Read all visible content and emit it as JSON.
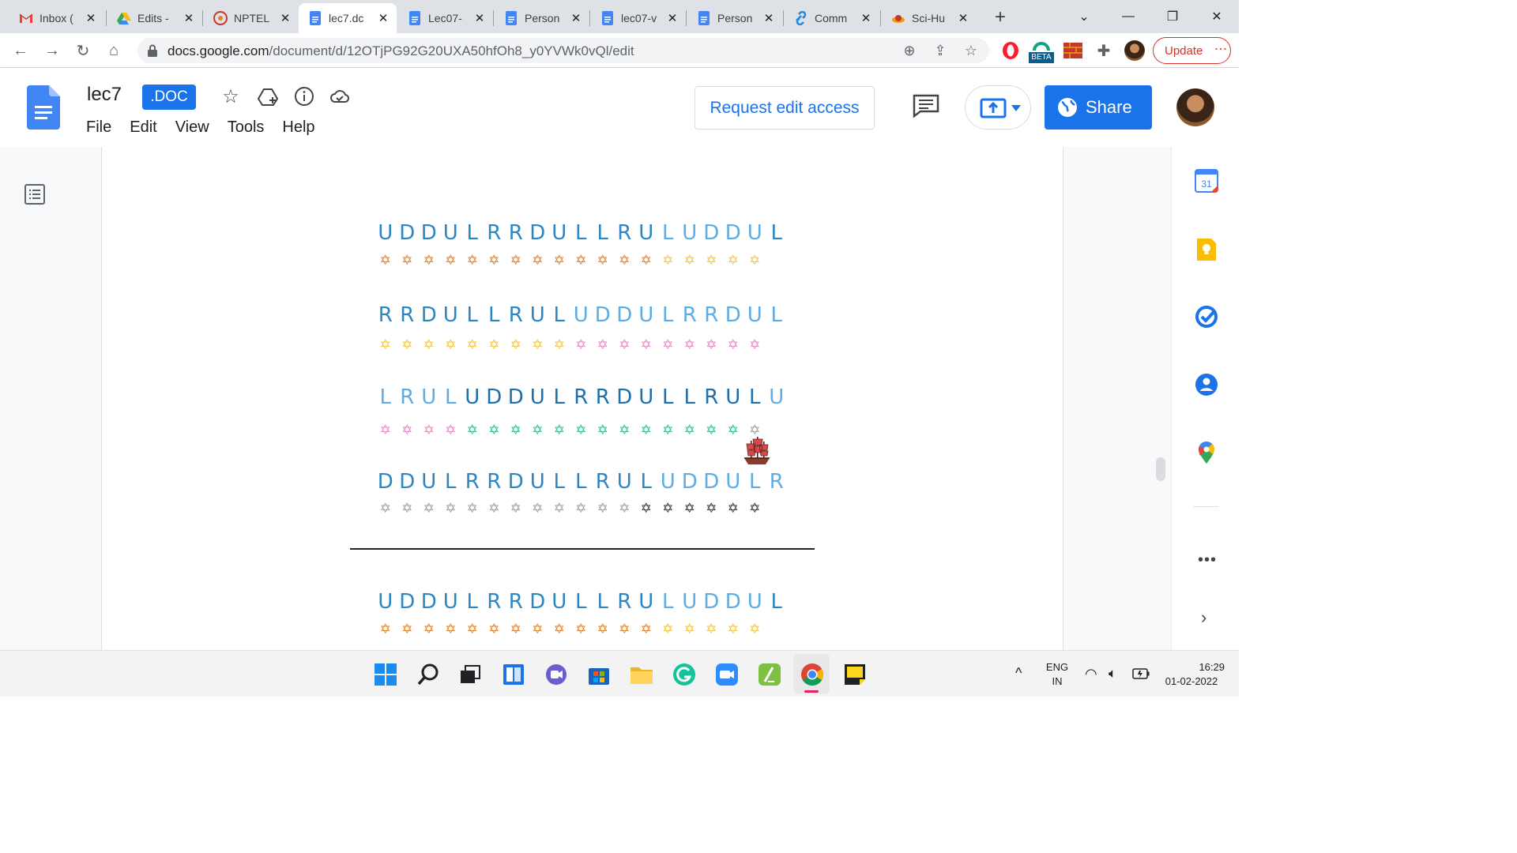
{
  "browser": {
    "tabs": [
      {
        "title": "Inbox (",
        "icon": "gmail-icon"
      },
      {
        "title": "Edits -",
        "icon": "drive-icon"
      },
      {
        "title": "NPTEL",
        "icon": "nptel-icon"
      },
      {
        "title": "lec7.dc",
        "icon": "docs-icon",
        "active": true
      },
      {
        "title": "Lec07-",
        "icon": "docs-icon"
      },
      {
        "title": "Person",
        "icon": "docs-icon"
      },
      {
        "title": "lec07-v",
        "icon": "docs-icon"
      },
      {
        "title": "Person",
        "icon": "docs-icon"
      },
      {
        "title": "Comm",
        "icon": "link-icon"
      },
      {
        "title": "Sci-Hu",
        "icon": "scihub-icon"
      }
    ],
    "url_host": "docs.google.com",
    "url_path": "/document/d/12OTjPG92G20UXA50hfOh8_y0YVWk0vQl/edit",
    "update_label": "Update",
    "extension_badge": "BETA"
  },
  "docs": {
    "title": "lec7",
    "badge": ".DOC",
    "menu": [
      "File",
      "Edit",
      "View",
      "Tools",
      "Help"
    ],
    "request_edit": "Request edit access",
    "share": "Share"
  },
  "document": {
    "blocks": [
      {
        "letters": "UDDULRRDULLRULUDDUL",
        "letter_colors": [
          "#2e86c1",
          "#2e86c1",
          "#2e86c1",
          "#2e86c1",
          "#2e86c1",
          "#2e86c1",
          "#2e86c1",
          "#2e86c1",
          "#2e86c1",
          "#2e86c1",
          "#2e86c1",
          "#2e86c1",
          "#2e86c1",
          "#5dade2",
          "#5dade2",
          "#5dade2",
          "#5dade2",
          "#5dade2"
        ],
        "star_colors": [
          "#e67e22",
          "#e67e22",
          "#e67e22",
          "#e67e22",
          "#e67e22",
          "#e67e22",
          "#e67e22",
          "#e67e22",
          "#e67e22",
          "#e67e22",
          "#e67e22",
          "#e67e22",
          "#e67e22",
          "#f4c542",
          "#f4c542",
          "#f4c542",
          "#f4c542",
          "#f4c542"
        ]
      },
      {
        "letters": "RRDULLRULUDDULRRDUL",
        "letter_colors": [
          "#2e86c1",
          "#2e86c1",
          "#2e86c1",
          "#2e86c1",
          "#2e86c1",
          "#2e86c1",
          "#2e86c1",
          "#2e86c1",
          "#2e86c1",
          "#5dade2",
          "#5dade2",
          "#5dade2",
          "#5dade2",
          "#5dade2",
          "#5dade2",
          "#5dade2",
          "#5dade2",
          "#5dade2",
          "#5dade2"
        ],
        "star_colors": [
          "#f4c542",
          "#f4c542",
          "#f4c542",
          "#f4c542",
          "#f4c542",
          "#f4c542",
          "#f4c542",
          "#f4c542",
          "#f4c542",
          "#e887c4",
          "#e887c4",
          "#e887c4",
          "#e887c4",
          "#e887c4",
          "#e887c4",
          "#e887c4",
          "#e887c4",
          "#e887c4"
        ]
      },
      {
        "letters": "LRULUDDULRRDULLRULU",
        "letter_colors": [
          "#5dade2",
          "#5dade2",
          "#5dade2",
          "#5dade2",
          "#1f6fa8",
          "#1f6fa8",
          "#1f6fa8",
          "#1f6fa8",
          "#1f6fa8",
          "#1f6fa8",
          "#1f6fa8",
          "#1f6fa8",
          "#1f6fa8",
          "#1f6fa8",
          "#1f6fa8",
          "#1f6fa8",
          "#1f6fa8",
          "#1f6fa8",
          "#5dade2"
        ],
        "star_colors": [
          "#e887c4",
          "#e887c4",
          "#e887c4",
          "#e887c4",
          "#2ebd8f",
          "#2ebd8f",
          "#2ebd8f",
          "#2ebd8f",
          "#2ebd8f",
          "#2ebd8f",
          "#2ebd8f",
          "#2ebd8f",
          "#2ebd8f",
          "#2ebd8f",
          "#2ebd8f",
          "#2ebd8f",
          "#2ebd8f",
          "#9e9e9e"
        ]
      },
      {
        "letters": "DDULRRDULLRULUDDULR",
        "letter_colors": [
          "#2e86c1",
          "#2e86c1",
          "#2e86c1",
          "#2e86c1",
          "#2e86c1",
          "#2e86c1",
          "#2e86c1",
          "#2e86c1",
          "#2e86c1",
          "#2e86c1",
          "#2e86c1",
          "#2e86c1",
          "#2e86c1",
          "#5dade2",
          "#5dade2",
          "#5dade2",
          "#5dade2",
          "#5dade2",
          "#5dade2"
        ],
        "star_colors": [
          "#9e9e9e",
          "#9e9e9e",
          "#9e9e9e",
          "#9e9e9e",
          "#9e9e9e",
          "#9e9e9e",
          "#9e9e9e",
          "#9e9e9e",
          "#9e9e9e",
          "#9e9e9e",
          "#9e9e9e",
          "#9e9e9e",
          "#333333",
          "#333333",
          "#333333",
          "#333333",
          "#333333",
          "#333333"
        ]
      },
      {
        "letters": "UDDULRRDULLRULUDDUL",
        "letter_colors": [
          "#2e86c1",
          "#2e86c1",
          "#2e86c1",
          "#2e86c1",
          "#2e86c1",
          "#2e86c1",
          "#2e86c1",
          "#2e86c1",
          "#2e86c1",
          "#2e86c1",
          "#2e86c1",
          "#2e86c1",
          "#2e86c1",
          "#5dade2",
          "#5dade2",
          "#5dade2",
          "#5dade2",
          "#5dade2"
        ],
        "star_colors": [
          "#e67e22",
          "#e67e22",
          "#e67e22",
          "#e67e22",
          "#e67e22",
          "#e67e22",
          "#e67e22",
          "#e67e22",
          "#e67e22",
          "#e67e22",
          "#e67e22",
          "#e67e22",
          "#e67e22",
          "#f4c542",
          "#f4c542",
          "#f4c542",
          "#f4c542",
          "#f4c542"
        ]
      }
    ]
  },
  "side_panel": [
    "calendar-icon",
    "keep-icon",
    "tasks-icon",
    "contacts-icon",
    "maps-icon"
  ],
  "side_panel_calendar_day": "31",
  "taskbar": {
    "lang_line1": "ENG",
    "lang_line2": "IN",
    "time": "16:29",
    "date": "01-02-2022"
  }
}
